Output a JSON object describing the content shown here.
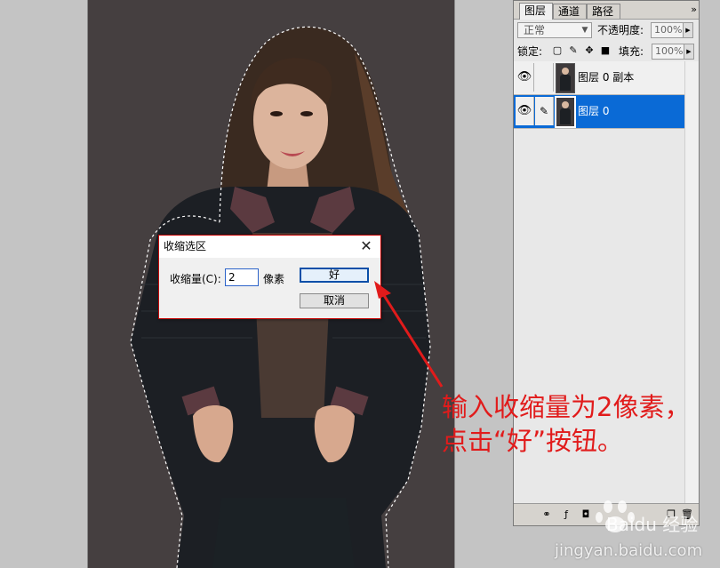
{
  "dialog": {
    "title": "收缩选区",
    "amount_label": "收缩量(C):",
    "amount_value": "2",
    "unit": "像素",
    "ok_label": "好",
    "cancel_label": "取消"
  },
  "layers_panel": {
    "tabs": [
      "图层",
      "通道",
      "路径"
    ],
    "menu_glyph": "»",
    "blend_mode": "正常",
    "opacity_label": "不透明度:",
    "opacity_value": "100%",
    "lock_label": "锁定:",
    "fill_label": "填充:",
    "fill_value": "100%",
    "layers": [
      {
        "name": "图层 0 副本",
        "selected": false
      },
      {
        "name": "图层 0",
        "selected": true
      }
    ]
  },
  "annotation": {
    "line1": "输入收缩量为2像素，",
    "line2": "点击“好”按钮。",
    "color": "#e11b1b"
  },
  "watermark": {
    "logo_text": "Baidu 经验",
    "url": "jingyan.baidu.com"
  }
}
